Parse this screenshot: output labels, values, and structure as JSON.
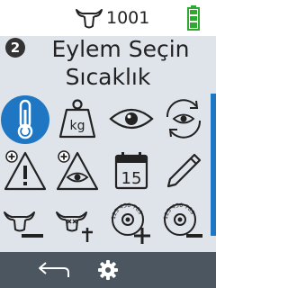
{
  "status_bar": {
    "animal_icon": "cow-head-icon",
    "count": "1001",
    "battery_icon": "battery-full-icon",
    "battery_color": "#2fa82f"
  },
  "header": {
    "step_number": "2",
    "title": "Eylem Seçin",
    "subtitle": "Sıcaklık"
  },
  "actions": [
    {
      "icon": "thermometer-icon",
      "selected": true
    },
    {
      "icon": "weight-kg-icon",
      "selected": false
    },
    {
      "icon": "eye-icon",
      "selected": false
    },
    {
      "icon": "eye-refresh-icon",
      "selected": false
    },
    {
      "icon": "alert-plus-icon",
      "selected": false
    },
    {
      "icon": "alert-eye-plus-icon",
      "selected": false
    },
    {
      "icon": "calendar-15-icon",
      "calendar_day": "15",
      "selected": false
    },
    {
      "icon": "pencil-icon",
      "selected": false
    },
    {
      "icon": "cow-minus-icon",
      "selected": false
    },
    {
      "icon": "cow-dead-icon",
      "selected": false
    },
    {
      "icon": "eartag-add-icon",
      "tag_text": "123 456 789",
      "selected": false
    },
    {
      "icon": "eartag-remove-icon",
      "tag_text": "123 456 789",
      "selected": false
    }
  ],
  "footer": {
    "back_icon": "back-arrow-icon",
    "settings_icon": "gear-icon"
  },
  "colors": {
    "accent": "#1f77c4",
    "panel": "#dfe3ea",
    "footer": "#4b5661"
  }
}
